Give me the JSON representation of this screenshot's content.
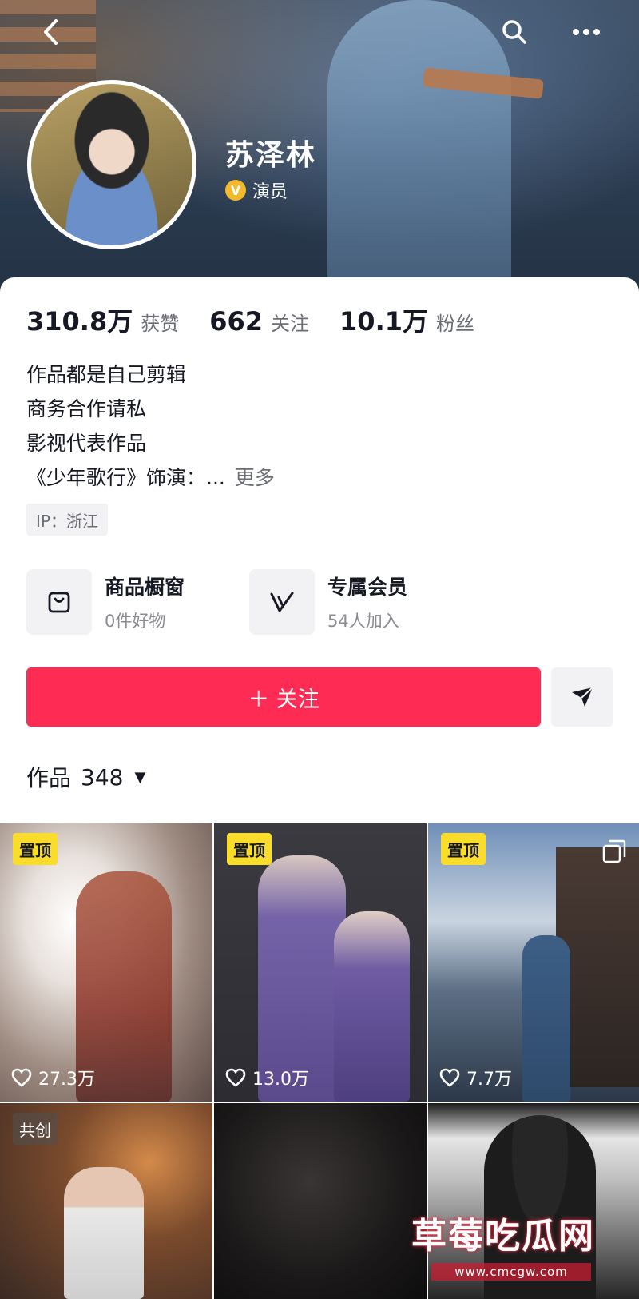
{
  "profile": {
    "name": "苏泽林",
    "verified_mark": "V",
    "role": "演员"
  },
  "stats": [
    {
      "value": "310.8万",
      "label": "获赞"
    },
    {
      "value": "662",
      "label": "关注"
    },
    {
      "value": "10.1万",
      "label": "粉丝"
    }
  ],
  "bio": {
    "lines": [
      "作品都是自己剪辑",
      "商务合作请私",
      "影视代表作品",
      "《少年歌行》饰演：..."
    ],
    "more_label": "更多"
  },
  "ip_location": "IP：浙江",
  "features": {
    "shop": {
      "title": "商品橱窗",
      "subtitle": "0件好物",
      "icon": "shopping-bag-icon"
    },
    "member": {
      "title": "专属会员",
      "subtitle": "54人加入",
      "icon": "v-member-icon"
    }
  },
  "actions": {
    "follow_label": "＋ 关注",
    "share_icon": "paper-plane-icon"
  },
  "works": {
    "label": "作品",
    "count": "348",
    "caret": "▼"
  },
  "grid": [
    {
      "badge": "置顶",
      "likes": "27.3万"
    },
    {
      "badge": "置顶",
      "likes": "13.0万"
    },
    {
      "badge": "置顶",
      "likes": "7.7万"
    },
    {
      "badge": "共创",
      "likes": ""
    },
    {
      "badge": "",
      "likes": ""
    },
    {
      "badge": "",
      "likes": ""
    }
  ],
  "watermark": {
    "title": "草莓吃瓜网",
    "url": "www.cmcgw.com"
  },
  "colors": {
    "follow_button": "#fe2c55",
    "pin_badge": "#fadd2b",
    "verified_badge": "#f3b92c"
  }
}
